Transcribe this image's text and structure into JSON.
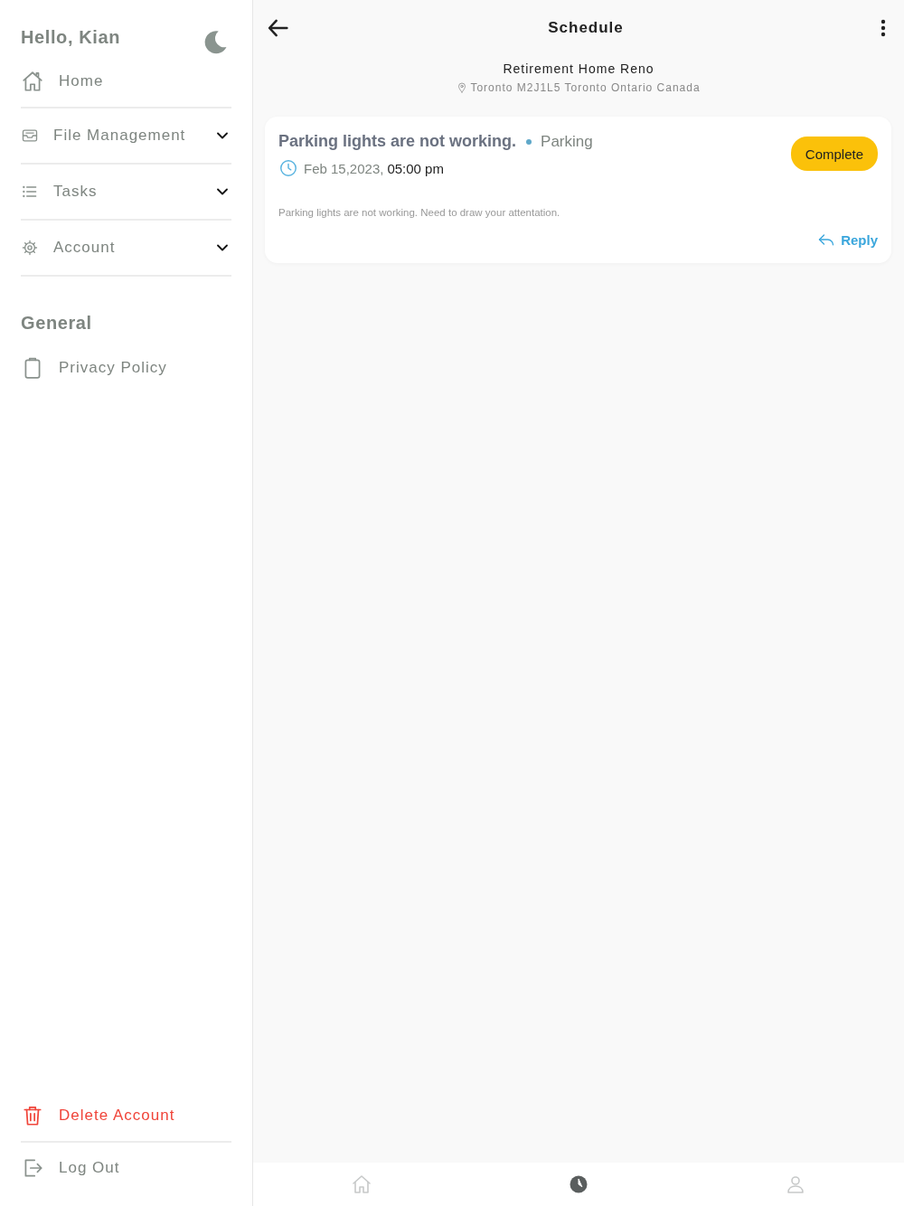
{
  "sidebar": {
    "greeting": "Hello, Kian",
    "items": [
      {
        "label": "Home",
        "kind": "link"
      },
      {
        "label": "File Management",
        "kind": "dropdown",
        "expanded": false
      },
      {
        "label": "Tasks",
        "kind": "dropdown",
        "expanded": false
      },
      {
        "label": "Account",
        "kind": "dropdown",
        "expanded": false
      }
    ],
    "general": {
      "heading": "General",
      "items": [
        {
          "label": "Privacy Policy"
        }
      ]
    },
    "footer": [
      {
        "label": "Delete Account",
        "kind": "danger"
      },
      {
        "label": "Log Out",
        "kind": "normal"
      }
    ]
  },
  "header": {
    "title": "Schedule"
  },
  "project": {
    "name": "Retirement Home Reno",
    "address": "Toronto M2J1L5 Toronto Ontario Canada"
  },
  "tasks": [
    {
      "title": "Parking lights are not working.",
      "category": "Parking",
      "color": "#5fa8c9",
      "date": "Feb 15,2023,",
      "time": "05:00 pm",
      "description": "Parking lights are not working. Need to draw your attentation.",
      "action": "Complete",
      "reply": "Reply"
    }
  ],
  "bottom_nav": [
    {
      "selected": false
    },
    {
      "selected": true
    },
    {
      "selected": false
    }
  ]
}
